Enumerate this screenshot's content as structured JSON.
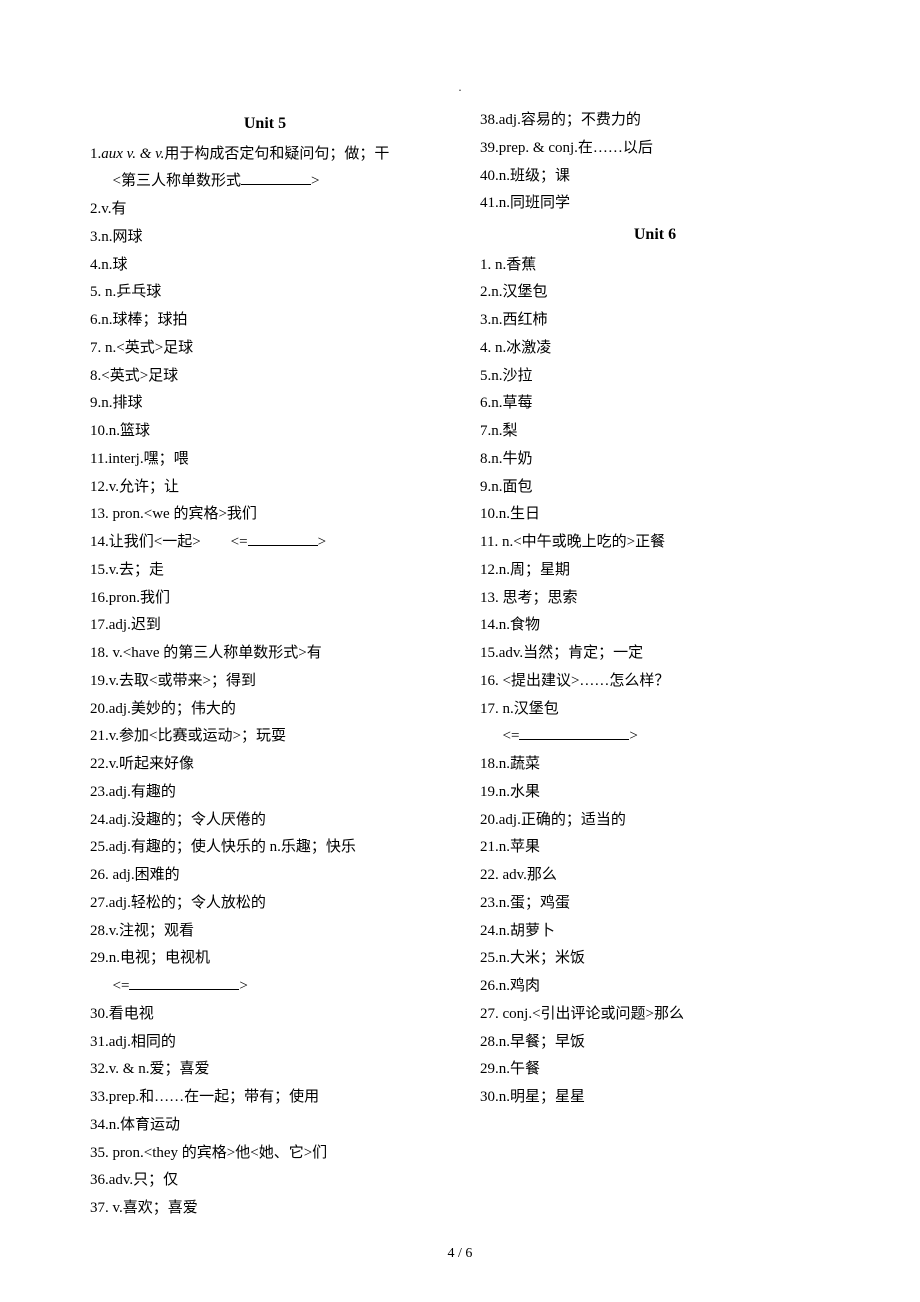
{
  "header_dot": ".",
  "unit5_title": "Unit 5",
  "unit6_title": "Unit 6",
  "unit5": [
    "1.aux v. & v.用于构成否定句和疑问句；做；干",
    "<第三人称单数形式",
    "2.v.有",
    "3.n.网球",
    "4.n.球",
    "5. n.乒乓球",
    "6.n.球棒；球拍",
    "7. n.<英式>足球",
    "8.<英式>足球",
    "9.n.排球",
    "10.n.篮球",
    "11.interj.嘿；喂",
    "12.v.允许；让",
    "13. pron.<we 的宾格>我们",
    "14.让我们<一起>",
    "15.v.去；走",
    "16.pron.我们",
    "17.adj.迟到",
    "18. v.<have 的第三人称单数形式>有",
    "19.v.去取<或带来>；得到",
    "20.adj.美妙的；伟大的",
    "21.v.参加<比赛或运动>；玩耍",
    "22.v.听起来好像",
    "23.adj.有趣的",
    "24.adj.没趣的；令人厌倦的",
    "25.adj.有趣的；使人快乐的   n.乐趣；快乐",
    "26. adj.困难的",
    "27.adj.轻松的；令人放松的",
    "28.v.注视；观看",
    "29.n.电视；电视机",
    "30.看电视",
    "31.adj.相同的",
    "32.v. & n.爱；喜爱",
    "33.prep.和……在一起；带有；使用",
    "34.n.体育运动",
    "35. pron.<they 的宾格>他<她、它>们"
  ],
  "unit5_continued": [
    "36.adv.只；仅",
    "37. v.喜欢；喜爱",
    "38.adj.容易的；不费力的",
    "39.prep. & conj.在……以后",
    "40.n.班级；课",
    "41.n.同班同学"
  ],
  "unit6": [
    "1. n.香蕉",
    "2.n.汉堡包",
    "3.n.西红柿",
    "4. n.冰激凌",
    "5.n.沙拉",
    "6.n.草莓",
    "7.n.梨",
    "8.n.牛奶",
    "9.n.面包",
    "10.n.生日",
    "11. n.<中午或晚上吃的>正餐",
    "12.n.周；星期",
    "13. 思考；思索",
    "14.n.食物",
    "15.adv.当然；肯定；一定",
    "16. <提出建议>……怎么样？",
    "17. n.汉堡包",
    "18.n.蔬菜",
    "19.n.水果",
    "20.adj.正确的；适当的",
    "21.n.苹果",
    "22. adv.那么",
    "23.n.蛋；鸡蛋",
    "24.n.胡萝卜",
    "25.n.大米；米饭",
    "26.n.鸡肉",
    "27. conj.<引出评论或问题>那么",
    "28.n.早餐；早饭",
    "29.n.午餐",
    "30.n.明星；星星"
  ],
  "footer": "4 / 6"
}
